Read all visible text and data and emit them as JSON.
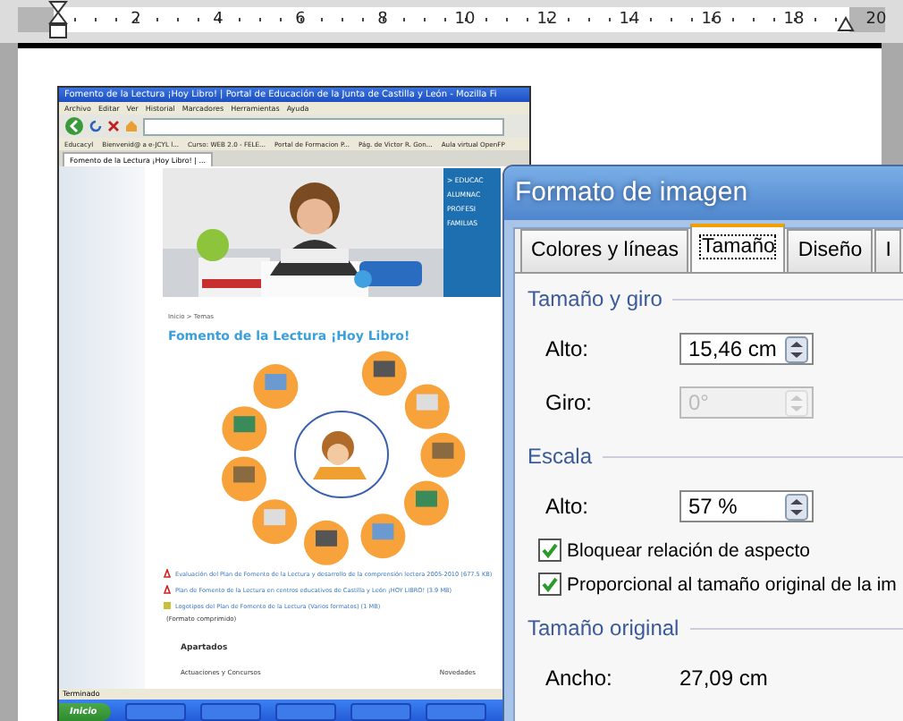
{
  "ruler": {
    "labels": [
      "2",
      "4",
      "6",
      "8",
      "10",
      "12",
      "14",
      "16",
      "18",
      "20"
    ]
  },
  "embedded_browser": {
    "title": "Fomento de la Lectura ¡Hoy Libro! | Portal de Educación de la Junta de Castilla y León - Mozilla Fi",
    "menu": [
      "Archivo",
      "Editar",
      "Ver",
      "Historial",
      "Marcadores",
      "Herramientas",
      "Ayuda"
    ],
    "bookmarks": [
      "Educacyl",
      "Bienvenid@ a e-JCYL l...",
      "Curso: WEB 2.0 - FELE...",
      "Portal de Formacion P...",
      "Pág. de Victor R. Gon...",
      "Aula virtual OpenFP"
    ],
    "tab": "Fomento de la Lectura ¡Hoy Libro! | ...",
    "nav": [
      "> EDUCAC",
      "ALUMNAC",
      "PROFESI",
      "FAMILIAS"
    ],
    "breadcrumb": "Inicio > Temas",
    "heading": "Fomento de la Lectura ¡Hoy Libro!",
    "links": [
      "Evaluación del Plan de Fomento de la Lectura y desarrollo de la comprensión lectora 2005-2010 (677.5 KB)",
      "Plan de Fomento de la Lectura en centros educativos de Castilla y León ¡HOY LIBRO! (3.9 MB)",
      "Logotipos del Plan de Fomento de la Lectura (Varios formatos) (1 MB)"
    ],
    "note": "(Formato comprimido)",
    "apartados_title": "Apartados",
    "apartados": [
      "Actuaciones y Concursos",
      "Novedades"
    ],
    "status": "Terminado",
    "start": "Inicio"
  },
  "dialog": {
    "title": "Formato de imagen",
    "tabs": [
      {
        "label": "Colores y líneas",
        "selected": false
      },
      {
        "label": "Tamaño",
        "selected": true
      },
      {
        "label": "Diseño",
        "selected": false
      },
      {
        "label": "I",
        "selected": false
      }
    ],
    "sections": [
      {
        "title": "Tamaño y giro",
        "rows": [
          {
            "kind": "spin",
            "label": "Alto:",
            "value": "15,46 cm",
            "disabled": false
          },
          {
            "kind": "spin",
            "label": "Giro:",
            "value": "0°",
            "disabled": true
          }
        ]
      },
      {
        "title": "Escala",
        "rows": [
          {
            "kind": "spin",
            "label": "Alto:",
            "value": "57 %",
            "disabled": false
          },
          {
            "kind": "checkbox",
            "label": "Bloquear relación de aspecto",
            "checked": true
          },
          {
            "kind": "checkbox",
            "label": "Proporcional al tamaño original de la im",
            "checked": true
          }
        ]
      },
      {
        "title": "Tamaño original",
        "rows": [
          {
            "kind": "readout",
            "label": "Ancho:",
            "value": "27,09 cm"
          }
        ]
      }
    ]
  }
}
